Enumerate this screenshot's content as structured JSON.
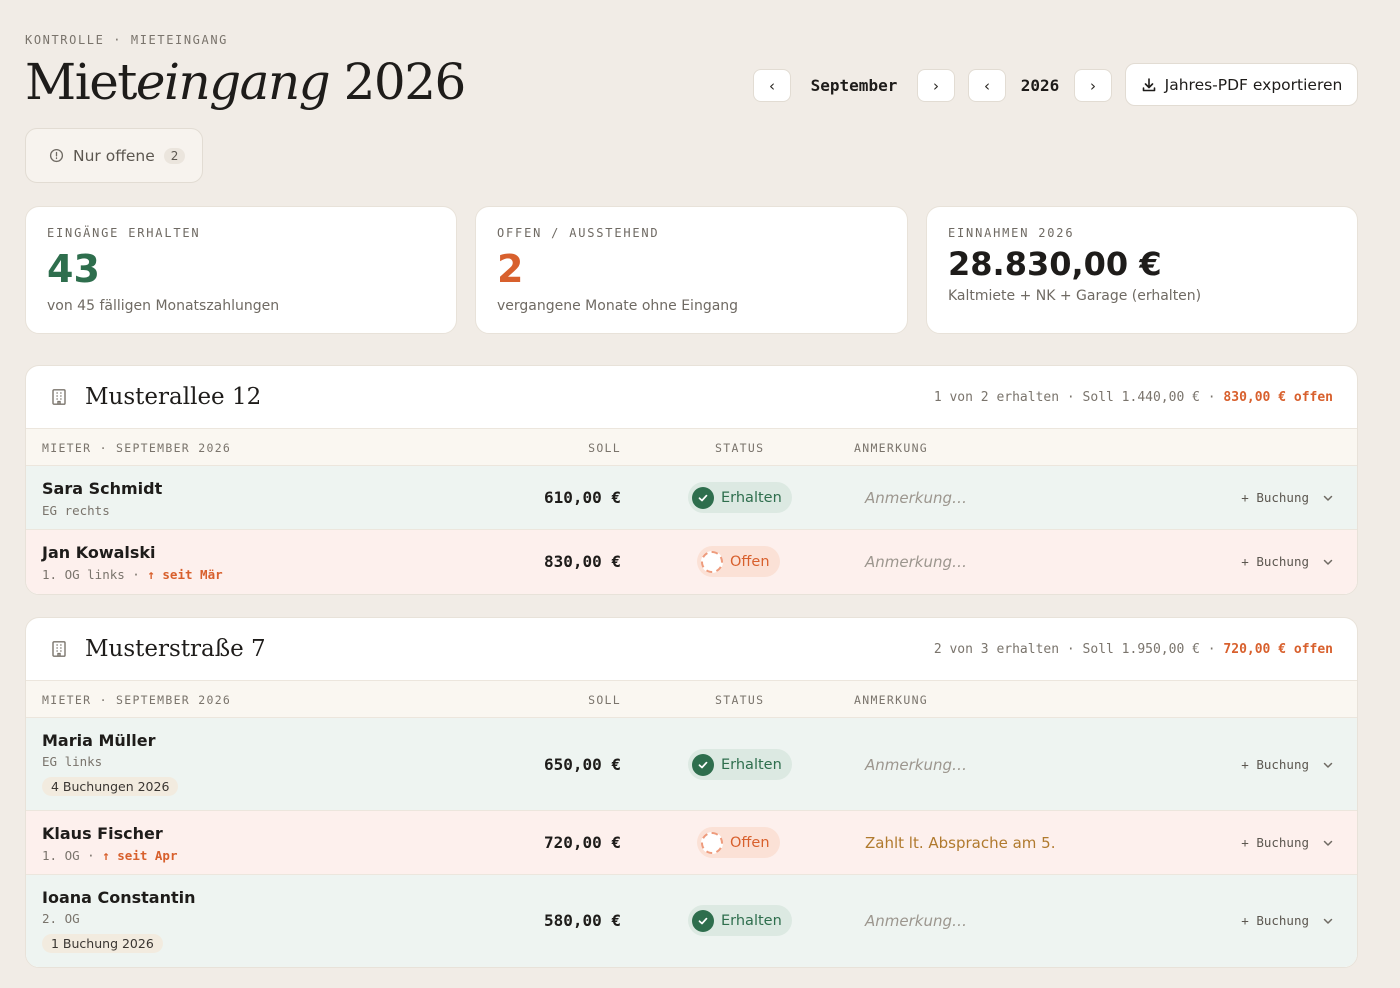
{
  "header": {
    "breadcrumb": "KONTROLLE · MIETEINGANG",
    "title_plain": "Miet",
    "title_italic": "eingang",
    "title_year": "2026",
    "month": "September",
    "year": "2026",
    "prev_icon": "‹",
    "next_icon": "›",
    "export_label": "Jahres-PDF exportieren"
  },
  "filter": {
    "label": "Nur offene",
    "count": "2"
  },
  "stats": [
    {
      "label": "EINGÄNGE ERHALTEN",
      "value": "43",
      "sub": "von 45 fälligen Monatszahlungen",
      "color": "#2e6e4d"
    },
    {
      "label": "OFFEN / AUSSTEHEND",
      "value": "2",
      "sub": "vergangene Monate ohne Eingang",
      "color": "#d8602d"
    },
    {
      "label": "EINNAHMEN 2026",
      "value": "28.830,00 €",
      "sub": "Kaltmiete + NK + Garage (erhalten)",
      "color": "#1e1c1a"
    }
  ],
  "columns": {
    "tenant": "MIETER · SEPTEMBER 2026",
    "soll": "SOLL",
    "status": "STATUS",
    "note": "ANMERKUNG"
  },
  "properties": [
    {
      "name": "Musterallee 12",
      "summary": "1 von 2 erhalten · Soll 1.440,00 € · ",
      "open": "830,00 € offen",
      "tenants": [
        {
          "name": "Sara Schmidt",
          "unit": "EG rechts",
          "since": "",
          "bookings": "",
          "soll": "610,00 €",
          "status": "Erhalten",
          "note": "Anmerkung…",
          "book": "+ Buchung"
        },
        {
          "name": "Jan Kowalski",
          "unit": "1. OG links · ",
          "since": "↑ seit Mär",
          "bookings": "",
          "soll": "830,00 €",
          "status": "Offen",
          "note": "Anmerkung…",
          "book": "+ Buchung"
        }
      ]
    },
    {
      "name": "Musterstraße 7",
      "summary": "2 von 3 erhalten · Soll 1.950,00 € · ",
      "open": "720,00 € offen",
      "tenants": [
        {
          "name": "Maria Müller",
          "unit": "EG links",
          "since": "",
          "bookings": "4 Buchungen 2026",
          "soll": "650,00 €",
          "status": "Erhalten",
          "note": "Anmerkung…",
          "book": "+ Buchung"
        },
        {
          "name": "Klaus Fischer",
          "unit": "1. OG · ",
          "since": "↑ seit Apr",
          "bookings": "",
          "soll": "720,00 €",
          "status": "Offen",
          "note": "Zahlt lt. Absprache am 5.",
          "book": "+ Buchung"
        },
        {
          "name": "Ioana Constantin",
          "unit": "2. OG",
          "since": "",
          "bookings": "1 Buchung 2026",
          "soll": "580,00 €",
          "status": "Erhalten",
          "note": "Anmerkung…",
          "book": "+ Buchung"
        }
      ]
    }
  ]
}
